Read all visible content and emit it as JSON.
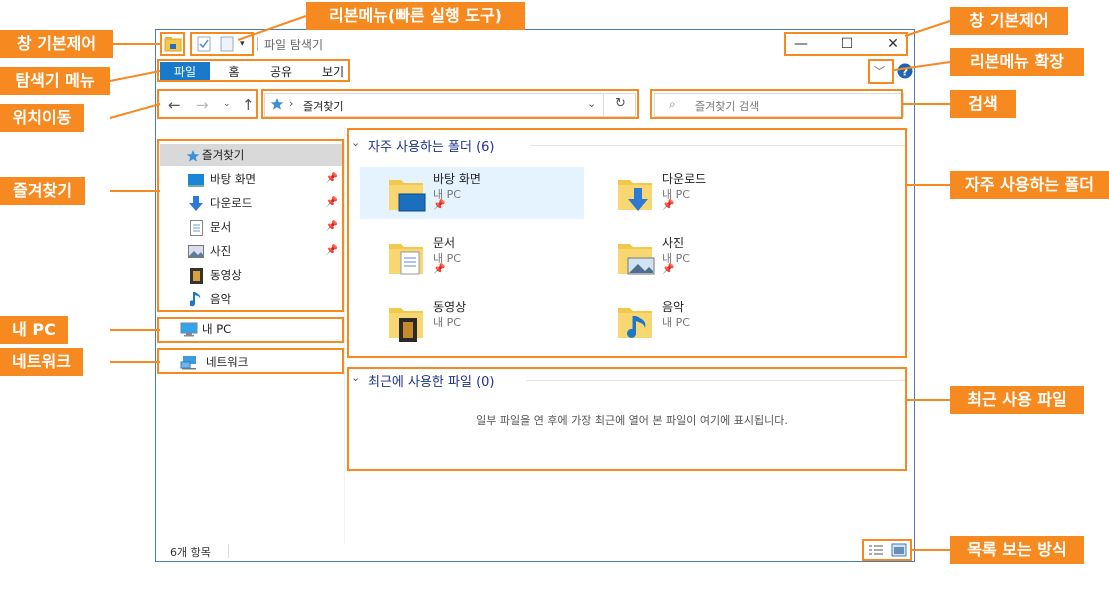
{
  "window": {
    "title": "파일 탐색기",
    "controls": {
      "minimize": "—",
      "maximize": "☐",
      "close": "✕"
    }
  },
  "ribbon_tabs": [
    "파일",
    "홈",
    "공유",
    "보기"
  ],
  "address_bar": {
    "path": "즐겨찾기",
    "search_placeholder": "즐겨찾기 검색"
  },
  "nav_pane": {
    "quick_access_label": "즐겨찾기",
    "quick_access_items": [
      {
        "label": "바탕 화면",
        "icon": "desktop-icon",
        "pinned": true
      },
      {
        "label": "다운로드",
        "icon": "download-icon",
        "pinned": true
      },
      {
        "label": "문서",
        "icon": "document-icon",
        "pinned": true
      },
      {
        "label": "사진",
        "icon": "picture-icon",
        "pinned": true
      },
      {
        "label": "동영상",
        "icon": "video-icon",
        "pinned": false
      },
      {
        "label": "음악",
        "icon": "music-icon",
        "pinned": false
      }
    ],
    "this_pc": "내 PC",
    "network": "네트워크"
  },
  "frequent_folders": {
    "header": "자주 사용하는 폴더 (6)",
    "items": [
      {
        "name": "바탕 화면",
        "location": "내 PC",
        "pinned": true
      },
      {
        "name": "다운로드",
        "location": "내 PC",
        "pinned": true
      },
      {
        "name": "문서",
        "location": "내 PC",
        "pinned": true
      },
      {
        "name": "사진",
        "location": "내 PC",
        "pinned": true
      },
      {
        "name": "동영상",
        "location": "내 PC",
        "pinned": false
      },
      {
        "name": "음악",
        "location": "내 PC",
        "pinned": false
      }
    ]
  },
  "recent_files": {
    "header": "최근에 사용한 파일 (0)",
    "empty_message": "일부 파일을 연 후에 가장 최근에 열어 본 파일이 여기에 표시됩니다."
  },
  "status_bar": {
    "item_count": "6개 항목"
  },
  "annotations": {
    "window_control_left": "창 기본제어",
    "quick_access_toolbar": "리본메뉴(빠른 실행 도구)",
    "window_control_right": "창 기본제어",
    "ribbon_expand": "리본메뉴 확장",
    "explorer_menu": "탐색기 메뉴",
    "navigation": "위치이동",
    "search": "검색",
    "favorites": "즐겨찾기",
    "frequent_folders": "자주 사용하는 폴더",
    "this_pc": "내 PC",
    "network": "네트워크",
    "recent_files": "최근 사용 파일",
    "view_mode": "목록 보는 방식"
  },
  "colors": {
    "accent": "#f6891f",
    "ribbon_file": "#1979ca",
    "header_text": "#1e3287",
    "selection": "#e5f3ff"
  }
}
